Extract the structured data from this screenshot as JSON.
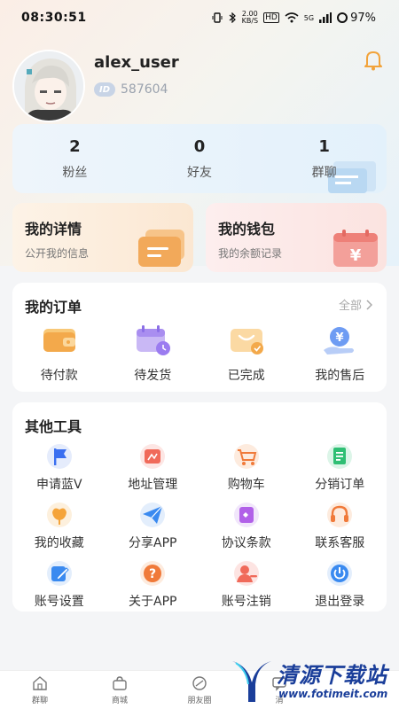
{
  "status_bar": {
    "time": "08:30:51",
    "net_speed_value": "2.00",
    "net_speed_unit": "KB/S",
    "hd_label": "HD",
    "signal_label": "5G",
    "battery": "97%"
  },
  "profile": {
    "username": "alex_user",
    "id_badge": "ID",
    "id_number": "587604"
  },
  "stats": [
    {
      "value": "2",
      "label": "粉丝"
    },
    {
      "value": "0",
      "label": "好友"
    },
    {
      "value": "1",
      "label": "群聊"
    }
  ],
  "cards": {
    "detail": {
      "title": "我的详情",
      "subtitle": "公开我的信息"
    },
    "wallet": {
      "title": "我的钱包",
      "subtitle": "我的余额记录",
      "icon_symbol": "¥"
    }
  },
  "orders": {
    "title": "我的订单",
    "see_all": "全部",
    "items": [
      {
        "label": "待付款",
        "icon": "wallet-icon"
      },
      {
        "label": "待发货",
        "icon": "calendar-clock-icon"
      },
      {
        "label": "已完成",
        "icon": "completed-box-icon"
      },
      {
        "label": "我的售后",
        "icon": "yen-hand-icon",
        "symbol": "¥"
      }
    ]
  },
  "tools": {
    "title": "其他工具",
    "items": [
      {
        "label": "申请蓝V",
        "icon": "flag-icon"
      },
      {
        "label": "地址管理",
        "icon": "map-icon"
      },
      {
        "label": "购物车",
        "icon": "cart-icon"
      },
      {
        "label": "分销订单",
        "icon": "document-icon"
      },
      {
        "label": "我的收藏",
        "icon": "flower-icon"
      },
      {
        "label": "分享APP",
        "icon": "paper-plane-icon"
      },
      {
        "label": "协议条款",
        "icon": "agreement-icon"
      },
      {
        "label": "联系客服",
        "icon": "headset-icon"
      },
      {
        "label": "账号设置",
        "icon": "edit-icon"
      },
      {
        "label": "关于APP",
        "icon": "question-icon",
        "symbol": "?"
      },
      {
        "label": "账号注销",
        "icon": "user-remove-icon"
      },
      {
        "label": "退出登录",
        "icon": "power-icon"
      }
    ]
  },
  "bottom_nav": [
    {
      "label": "群聊",
      "icon": "home-icon"
    },
    {
      "label": "商城",
      "icon": "shop-bag-icon"
    },
    {
      "label": "朋友圈",
      "icon": "moments-icon"
    },
    {
      "label": "消",
      "icon": "message-icon"
    }
  ],
  "watermark": {
    "text": "清源下载站",
    "url": "www.fotimeit.com"
  },
  "colors": {
    "accent_blue": "#3a6ff0",
    "accent_orange": "#f5a43a",
    "accent_red": "#f06a5a",
    "accent_green": "#2fbf74",
    "accent_purple": "#9b7cf0"
  }
}
